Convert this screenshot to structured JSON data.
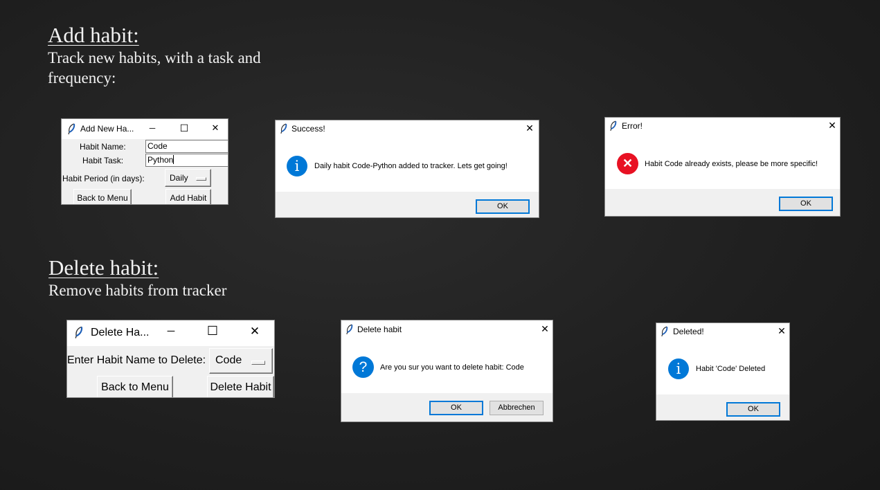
{
  "sections": {
    "add": {
      "heading": "Add habit:",
      "subtitle_line1": "Track new habits, with a task and",
      "subtitle_line2": "frequency:"
    },
    "delete": {
      "heading": "Delete habit:",
      "subtitle": "Remove habits from tracker"
    }
  },
  "add_window": {
    "title": "Add New Ha...",
    "habit_name_label": "Habit Name:",
    "habit_name_value": "Code",
    "habit_task_label": "Habit Task:",
    "habit_task_value": "Python",
    "period_label": "Habit Period (in days):",
    "period_value": "Daily",
    "back_button": "Back to Menu",
    "add_button": "Add Habit"
  },
  "success_dialog": {
    "title": "Success!",
    "message": "Daily habit Code-Python added to tracker. Lets get going!",
    "ok": "OK"
  },
  "error_dialog": {
    "title": "Error!",
    "message": "Habit Code already exists, please be more specific!",
    "ok": "OK"
  },
  "delete_window": {
    "title": "Delete Ha...",
    "label": "Enter Habit Name to Delete:",
    "value": "Code",
    "back_button": "Back to Menu",
    "delete_button": "Delete Habit"
  },
  "confirm_dialog": {
    "title": "Delete habit",
    "message": "Are you sur you want to delete habit: Code",
    "ok": "OK",
    "cancel": "Abbrechen"
  },
  "deleted_dialog": {
    "title": "Deleted!",
    "message": "Habit 'Code' Deleted",
    "ok": "OK"
  },
  "icons": {
    "window": "feather-icon",
    "info": "info-icon",
    "error": "error-icon",
    "question": "question-icon"
  },
  "colors": {
    "accent": "#0078d7",
    "error": "#e81123",
    "background": "#222222"
  },
  "glyphs": {
    "minimize": "─",
    "maximize": "☐",
    "close": "✕",
    "info": "i",
    "error": "✕",
    "question": "?"
  }
}
